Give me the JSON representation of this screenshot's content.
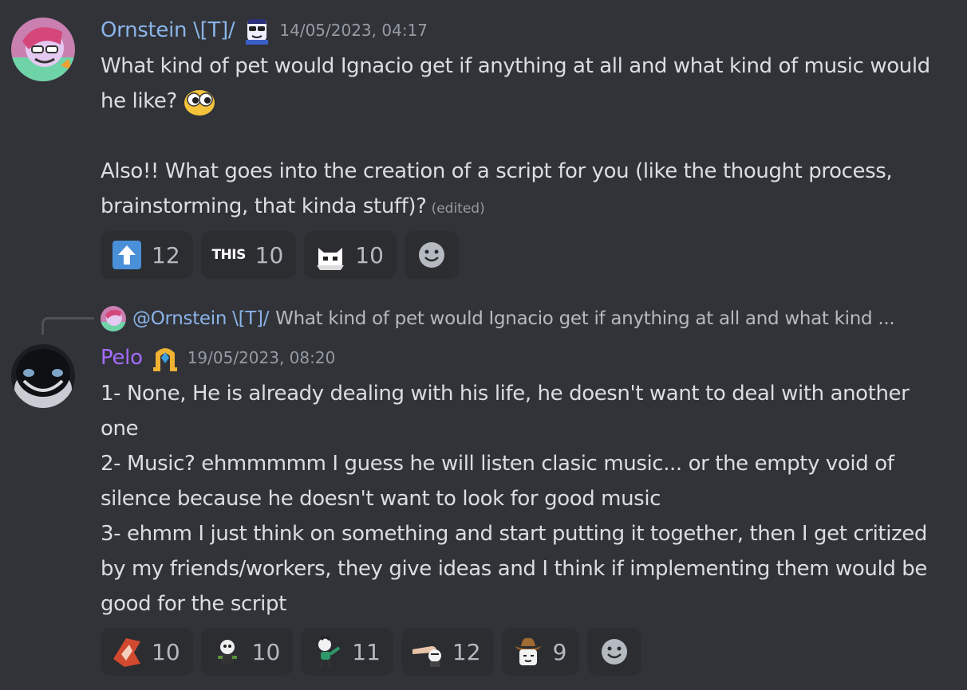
{
  "messages": [
    {
      "author": "Ornstein \\[T]/",
      "author_color": "#8ab4e8",
      "role_icon": "glasses-face-icon",
      "timestamp": "14/05/2023, 04:17",
      "paragraph1": "What kind of pet would Ignacio get if anything at all and what kind of music would he like?",
      "inline_emoji": "googly-eyes-emoji-icon",
      "paragraph2": "Also!! What goes into the creation of a script for you (like the thought process, brainstorming, that kinda stuff)?",
      "edited_label": "(edited)",
      "reactions": [
        {
          "emoji": "up-arrow-emoji-icon",
          "count": "12"
        },
        {
          "emoji": "this-text-emoji-icon",
          "label": "THIS",
          "count": "10"
        },
        {
          "emoji": "cat-emoji-icon",
          "count": "10"
        }
      ]
    },
    {
      "author": "Pelo",
      "author_color": "#a56bff",
      "role_icon": "gold-badge-icon",
      "timestamp": "19/05/2023, 08:20",
      "reply": {
        "author": "@Ornstein \\[T]/",
        "preview": "What kind of pet would Ignacio get if anything at all and what kind ..."
      },
      "lines": [
        "1- None, He is already dealing with his life, he doesn't want to deal with another one",
        "2- Music? ehmmmmm I guess he will listen clasic music... or the empty void of silence because he doesn't want to look for good music",
        "3- ehmm I just think on something and start putting it together, then I get critized by my friends/workers, they give ideas and I think if implementing them would be good for the script"
      ],
      "reactions": [
        {
          "emoji": "red-logo-emoji-icon",
          "count": "10"
        },
        {
          "emoji": "skull-character-emoji-icon",
          "count": "10"
        },
        {
          "emoji": "dancing-character-emoji-icon",
          "count": "11"
        },
        {
          "emoji": "hand-character-emoji-icon",
          "count": "12"
        },
        {
          "emoji": "cowboy-character-emoji-icon",
          "count": "9"
        }
      ]
    }
  ]
}
